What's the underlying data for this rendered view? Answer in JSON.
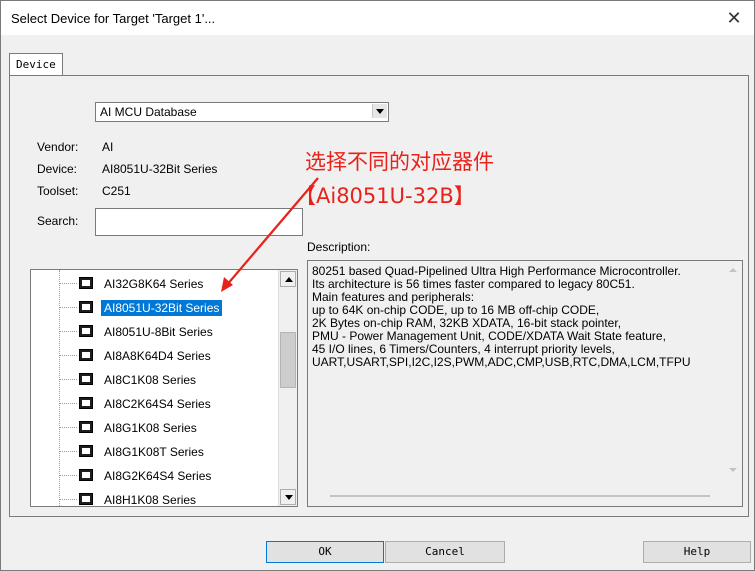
{
  "window": {
    "title": "Select Device for Target 'Target 1'...",
    "close_glyph": "✕"
  },
  "tab": {
    "label": "Device"
  },
  "database": {
    "selected": "AI MCU Database"
  },
  "vendor": {
    "label": "Vendor:",
    "value": "AI"
  },
  "device": {
    "label": "Device:",
    "value": "AI8051U-32Bit Series"
  },
  "toolset": {
    "label": "Toolset:",
    "value": "C251"
  },
  "search": {
    "label": "Search:",
    "value": ""
  },
  "description": {
    "label": "Description:",
    "text": "80251 based Quad-Pipelined Ultra High Performance Microcontroller.\nIts architecture is 56 times faster compared to legacy 80C51.\nMain features and peripherals:\nup to 64K on-chip CODE, up to 16 MB off-chip CODE,\n2K Bytes on-chip RAM, 32KB XDATA, 16-bit stack pointer,\nPMU - Power Management Unit, CODE/XDATA Wait State feature,\n45 I/O lines, 6 Timers/Counters, 4 interrupt priority levels,\nUART,USART,SPI,I2C,I2S,PWM,ADC,CMP,USB,RTC,DMA,LCM,TFPU"
  },
  "annotation": {
    "line1": "选择不同的对应器件",
    "line2": "【Ai8051U-32B】",
    "color": "#e8221a"
  },
  "device_tree": {
    "selected_index": 1,
    "items": [
      {
        "label": "AI32G8K64 Series"
      },
      {
        "label": "AI8051U-32Bit Series"
      },
      {
        "label": "AI8051U-8Bit Series"
      },
      {
        "label": "AI8A8K64D4 Series"
      },
      {
        "label": "AI8C1K08 Series"
      },
      {
        "label": "AI8C2K64S4 Series"
      },
      {
        "label": "AI8G1K08 Series"
      },
      {
        "label": "AI8G1K08T Series"
      },
      {
        "label": "AI8G2K64S4 Series"
      },
      {
        "label": "AI8H1K08 Series"
      }
    ]
  },
  "buttons": {
    "ok": "OK",
    "cancel": "Cancel",
    "help": "Help"
  }
}
